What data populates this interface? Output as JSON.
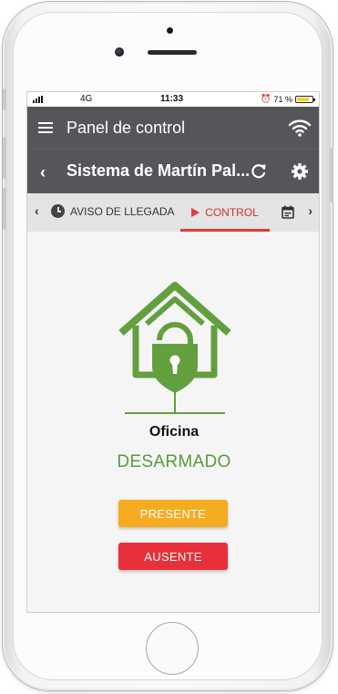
{
  "status_bar": {
    "network": "4G",
    "time": "11:33",
    "battery": "71 %"
  },
  "header": {
    "title": "Panel de control",
    "menu_icon": "hamburger-menu-icon",
    "wifi_icon": "wifi-icon"
  },
  "system_bar": {
    "title": "Sistema de Martín Pal...",
    "back_icon": "chevron-left-icon",
    "refresh_icon": "refresh-icon",
    "settings_icon": "gear-icon"
  },
  "tabs": {
    "items": [
      {
        "label": "AVISO DE LLEGADA",
        "icon": "clock-icon",
        "active": false
      },
      {
        "label": "CONTROL",
        "icon": "play-icon",
        "active": true
      },
      {
        "label": "",
        "icon": "calendar-icon",
        "active": false
      }
    ]
  },
  "zone": {
    "name": "Oficina",
    "state": "DESARMADO",
    "state_color": "#5a9a3a",
    "icon": "house-unlocked-icon"
  },
  "actions": {
    "presente_label": "PRESENTE",
    "presente_color": "#f6ac20",
    "ausente_label": "AUSENTE",
    "ausente_color": "#e8303a"
  },
  "colors": {
    "toolbar": "#555659",
    "active_tab": "#e53935",
    "brand_green": "#5a9a3a"
  }
}
